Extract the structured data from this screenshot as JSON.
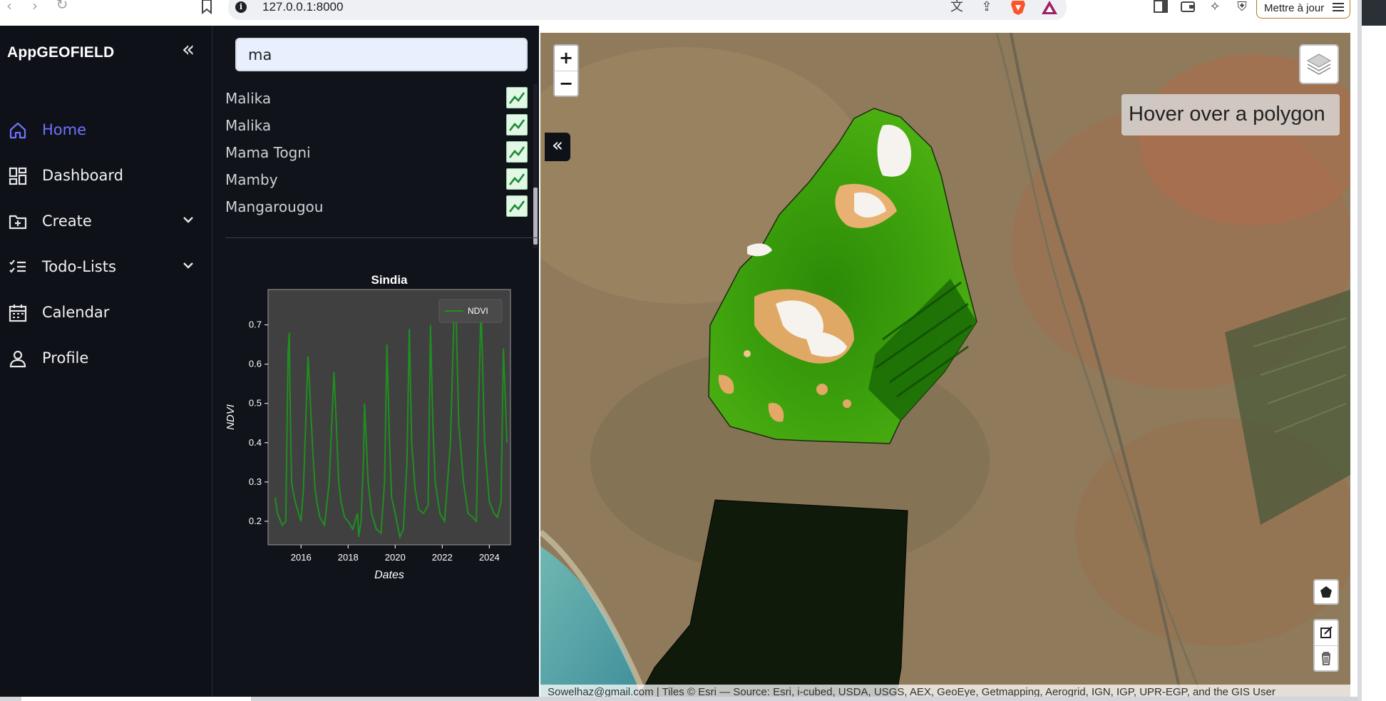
{
  "browser": {
    "url": "127.0.0.1:8000",
    "update_button": "Mettre à jour"
  },
  "sidebar": {
    "brand": "AppGEOFIELD",
    "items": [
      {
        "label": "Home",
        "icon": "home-icon",
        "active": true
      },
      {
        "label": "Dashboard",
        "icon": "dashboard-icon"
      },
      {
        "label": "Create",
        "icon": "folder-plus-icon",
        "expandable": true
      },
      {
        "label": "Todo-Lists",
        "icon": "checklist-icon",
        "expandable": true
      },
      {
        "label": "Calendar",
        "icon": "calendar-icon"
      },
      {
        "label": "Profile",
        "icon": "user-icon"
      }
    ],
    "active_color": "#6f73ff"
  },
  "search": {
    "value": "ma"
  },
  "results": [
    {
      "name": "Malika"
    },
    {
      "name": "Malika"
    },
    {
      "name": "Mama Togni"
    },
    {
      "name": "Mamby"
    },
    {
      "name": "Mangarougou"
    }
  ],
  "chart_data": {
    "type": "line",
    "title": "Sindia",
    "xlabel": "Dates",
    "ylabel": "NDVI",
    "legend": "NDVI",
    "legend_position": "top-right",
    "xlim": [
      2014.6,
      2024.9
    ],
    "ylim": [
      0.14,
      0.79
    ],
    "xticks": [
      "2016",
      "2018",
      "2020",
      "2022",
      "2024"
    ],
    "yticks": [
      "0.2",
      "0.3",
      "0.4",
      "0.5",
      "0.6",
      "0.7"
    ],
    "line_color": "#1f8f1f",
    "series": [
      {
        "name": "NDVI",
        "x": [
          2014.9,
          2015.0,
          2015.2,
          2015.35,
          2015.45,
          2015.5,
          2015.55,
          2015.6,
          2015.65,
          2015.75,
          2015.9,
          2016.0,
          2016.1,
          2016.3,
          2016.5,
          2016.6,
          2016.7,
          2016.8,
          2017.0,
          2017.2,
          2017.4,
          2017.5,
          2017.6,
          2017.7,
          2017.85,
          2018.0,
          2018.2,
          2018.4,
          2018.45,
          2018.55,
          2018.65,
          2018.7,
          2018.85,
          2019.0,
          2019.2,
          2019.4,
          2019.55,
          2019.65,
          2019.75,
          2019.85,
          2020.0,
          2020.2,
          2020.35,
          2020.5,
          2020.6,
          2020.7,
          2020.85,
          2021.0,
          2021.2,
          2021.4,
          2021.5,
          2021.6,
          2021.7,
          2021.9,
          2022.1,
          2022.35,
          2022.5,
          2022.6,
          2022.7,
          2022.9,
          2023.1,
          2023.3,
          2023.45,
          2023.55,
          2023.65,
          2023.8,
          2024.0,
          2024.2,
          2024.35,
          2024.5,
          2024.6,
          2024.75
        ],
        "values": [
          0.26,
          0.22,
          0.19,
          0.2,
          0.63,
          0.68,
          0.45,
          0.3,
          0.28,
          0.25,
          0.22,
          0.2,
          0.28,
          0.62,
          0.38,
          0.28,
          0.24,
          0.21,
          0.19,
          0.3,
          0.58,
          0.45,
          0.3,
          0.25,
          0.21,
          0.2,
          0.18,
          0.22,
          0.16,
          0.2,
          0.35,
          0.5,
          0.3,
          0.22,
          0.18,
          0.17,
          0.3,
          0.65,
          0.42,
          0.26,
          0.22,
          0.16,
          0.18,
          0.35,
          0.69,
          0.4,
          0.28,
          0.23,
          0.22,
          0.24,
          0.7,
          0.45,
          0.3,
          0.22,
          0.2,
          0.4,
          0.73,
          0.7,
          0.45,
          0.3,
          0.22,
          0.21,
          0.2,
          0.5,
          0.75,
          0.4,
          0.25,
          0.22,
          0.21,
          0.25,
          0.64,
          0.4
        ]
      }
    ]
  },
  "map": {
    "zoom_in": "+",
    "zoom_out": "−",
    "hover_text": "Hover over a polygon",
    "attribution": "Sowelhaz@gmail.com | Tiles © Esri — Source: Esri, i-cubed, USDA, USGS, AEX, GeoEye, Getmapping, Aerogrid, IGN, IGP, UPR-EGP, and the GIS User"
  }
}
